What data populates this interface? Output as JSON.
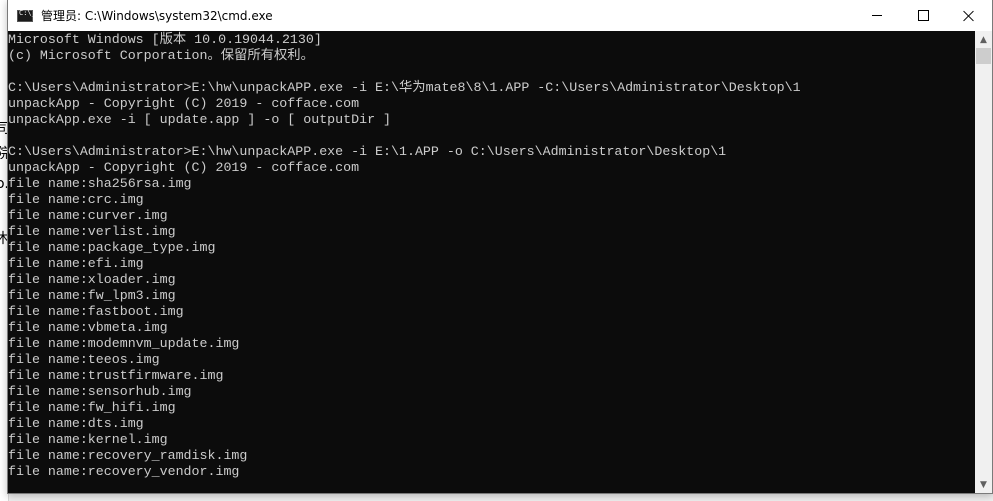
{
  "background_window": {
    "glyphs": [
      "司",
      "院",
      "o.",
      "木"
    ]
  },
  "window": {
    "title": "管理员: C:\\Windows\\system32\\cmd.exe",
    "icon": "cmd-icon",
    "controls": {
      "minimize": "minimize-icon",
      "maximize": "maximize-icon",
      "close": "close-icon"
    }
  },
  "console": {
    "foreground_color": "#cccccc",
    "background_color": "#0c0c0c",
    "lines": [
      "Microsoft Windows [版本 10.0.19044.2130]",
      "(c) Microsoft Corporation。保留所有权利。",
      "",
      "C:\\Users\\Administrator>E:\\hw\\unpackAPP.exe -i E:\\华为mate8\\8\\1.APP -C:\\Users\\Administrator\\Desktop\\1",
      "unpackApp - Copyright (C) 2019 - cofface.com",
      "unpackApp.exe -i [ update.app ] -o [ outputDir ]",
      "",
      "C:\\Users\\Administrator>E:\\hw\\unpackAPP.exe -i E:\\1.APP -o C:\\Users\\Administrator\\Desktop\\1",
      "unpackApp - Copyright (C) 2019 - cofface.com",
      "file name:sha256rsa.img",
      "file name:crc.img",
      "file name:curver.img",
      "file name:verlist.img",
      "file name:package_type.img",
      "file name:efi.img",
      "file name:xloader.img",
      "file name:fw_lpm3.img",
      "file name:fastboot.img",
      "file name:vbmeta.img",
      "file name:modemnvm_update.img",
      "file name:teeos.img",
      "file name:trustfirmware.img",
      "file name:sensorhub.img",
      "file name:fw_hifi.img",
      "file name:dts.img",
      "file name:kernel.img",
      "file name:recovery_ramdisk.img",
      "file name:recovery_vendor.img"
    ]
  },
  "scrollbar": {
    "up_arrow": "▲",
    "down_arrow": "▼"
  }
}
